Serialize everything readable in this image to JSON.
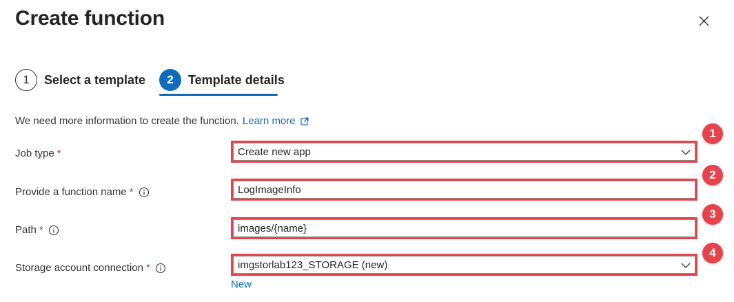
{
  "dialog": {
    "title": "Create function",
    "close_icon": "close-icon"
  },
  "steps": [
    {
      "number": "1",
      "label": "Select a template",
      "active": false
    },
    {
      "number": "2",
      "label": "Template details",
      "active": true
    }
  ],
  "info": {
    "text": "We need more information to create the function.",
    "link_label": "Learn more",
    "link_icon": "external-link-icon"
  },
  "fields": {
    "job_type": {
      "label": "Job type",
      "required": "*",
      "value": "Create new app",
      "badge": "1"
    },
    "function_name": {
      "label": "Provide a function name",
      "required": "*",
      "value": "LogImageInfo",
      "badge": "2"
    },
    "path": {
      "label": "Path",
      "required": "*",
      "value": "images/{name}",
      "badge": "3"
    },
    "storage": {
      "label": "Storage account connection",
      "required": "*",
      "value": "imgstorlab123_STORAGE (new)",
      "badge": "4",
      "new_link": "New"
    }
  },
  "colors": {
    "accent": "#0f6cbd",
    "highlight": "#e8424c",
    "required": "#c4314b"
  }
}
